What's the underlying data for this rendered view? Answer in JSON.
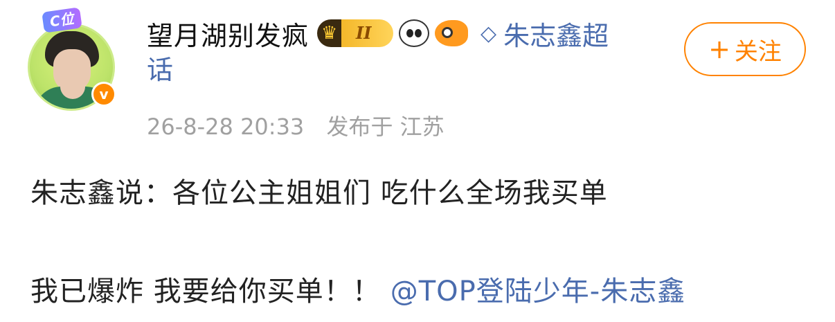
{
  "avatar": {
    "badge_text": "C位",
    "verified_text": "v"
  },
  "header": {
    "username": "望月湖别发疯",
    "level_label": "II",
    "topic_text": "朱志鑫超",
    "topic_text_cont": "话",
    "timestamp": "26-8-28 20:33",
    "location": "发布于 江苏"
  },
  "follow_button": {
    "plus": "+",
    "label": "关注"
  },
  "post": {
    "line1": "朱志鑫说：各位公主姐姐们 吃什么全场我买单",
    "line2": "我已爆炸 我要给你买单！！",
    "mention": "@TOP登陆少年-朱志鑫"
  },
  "colors": {
    "link": "#4a6cae",
    "accent": "#ff8200",
    "meta": "#a0a0a0"
  },
  "icons": [
    "crown-level-icon",
    "panda-icon",
    "fish-icon",
    "diamond-icon"
  ]
}
